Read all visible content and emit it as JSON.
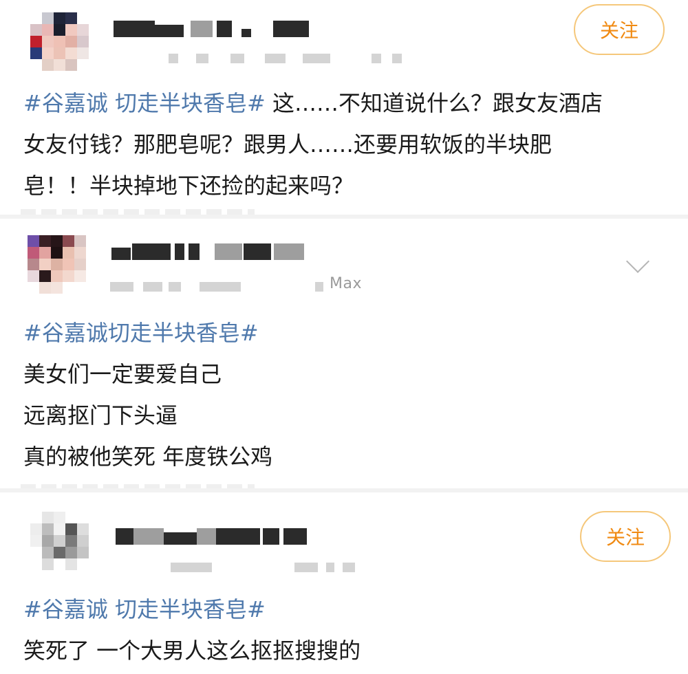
{
  "posts": [
    {
      "follow_label": "关注",
      "hashtag": "#谷嘉诚 切走半块香皂#",
      "lines": [
        " 这……不知道说什么？跟女友酒店",
        "女友付钱？那肥皂呢？跟男人……还要用软饭的半块肥",
        "皂！！半块掉地下还捡的起来吗？"
      ]
    },
    {
      "device_source": "Max",
      "hashtag": "#谷嘉诚切走半块香皂#",
      "lines": [
        "美女们一定要爱自己",
        "远离抠门下头逼",
        "真的被他笑死 年度铁公鸡"
      ]
    },
    {
      "follow_label": "关注",
      "hashtag": "#谷嘉诚 切走半块香皂#",
      "lines": [
        "笑死了 一个大男人这么抠抠搜搜的"
      ]
    }
  ],
  "icons": {
    "collapse": "chevron-down-icon"
  },
  "colors": {
    "hashtag": "#4f79ac",
    "follow_text": "#f08a12",
    "follow_border": "#f5c77a"
  }
}
